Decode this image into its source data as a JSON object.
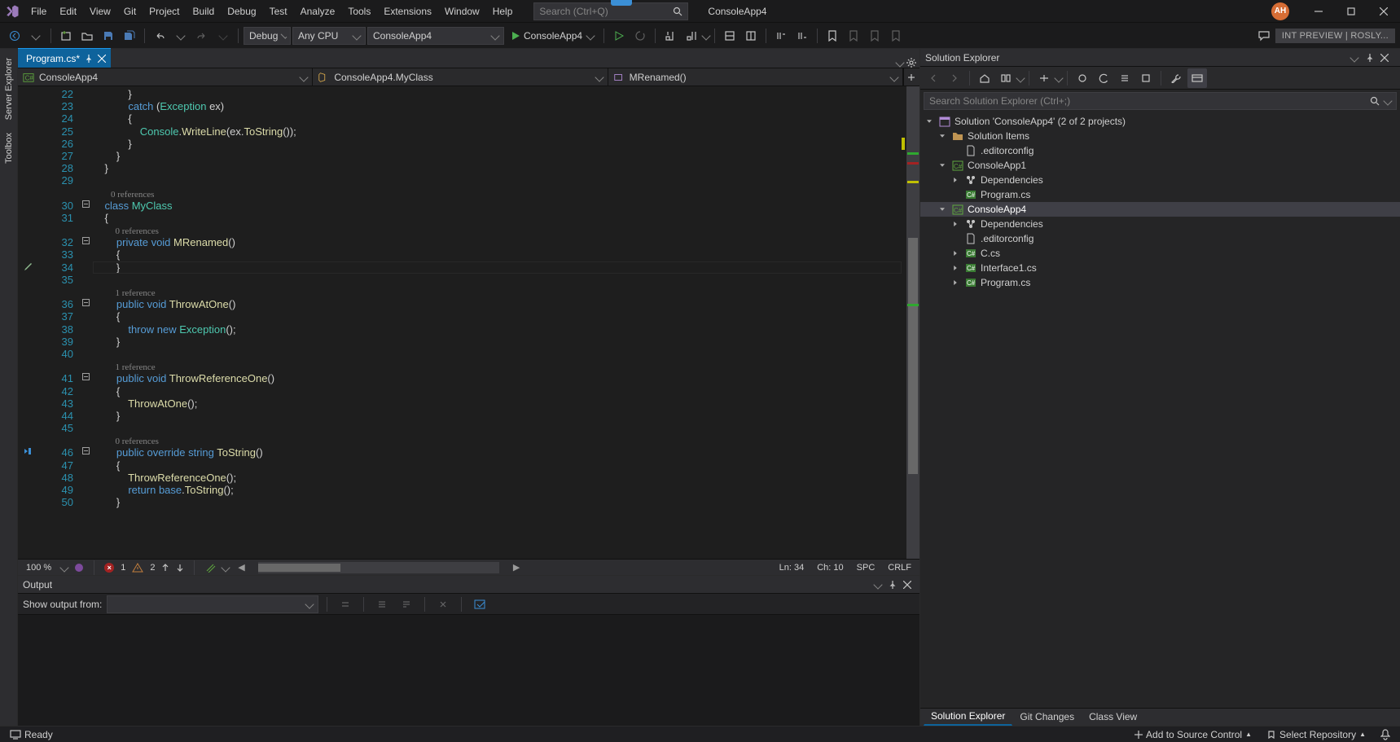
{
  "app_name": "ConsoleApp4",
  "menus": [
    "File",
    "Edit",
    "View",
    "Git",
    "Project",
    "Build",
    "Debug",
    "Test",
    "Analyze",
    "Tools",
    "Extensions",
    "Window",
    "Help"
  ],
  "search_placeholder": "Search (Ctrl+Q)",
  "avatar_initials": "AH",
  "toolbar": {
    "config": "Debug",
    "platform": "Any CPU",
    "startup": "ConsoleApp4",
    "run_label": "ConsoleApp4",
    "preview_badge": "INT PREVIEW | ROSLY..."
  },
  "left_rails": [
    "Server Explorer",
    "Toolbox"
  ],
  "doc_tab": {
    "title": "Program.cs*"
  },
  "navbar": {
    "project": "ConsoleApp4",
    "type": "ConsoleApp4.MyClass",
    "member": "MRenamed()"
  },
  "chart_data": null,
  "editor": {
    "first_line": 22,
    "lines": [
      {
        "n": 22,
        "html": "            }",
        "fold": false,
        "track": ""
      },
      {
        "n": 23,
        "html": "            <span class='kw'>catch</span> (<span class='tp'>Exception</span> ex)",
        "fold": false
      },
      {
        "n": 24,
        "html": "            {",
        "fold": false
      },
      {
        "n": 25,
        "html": "                <span class='tp'>Console</span>.<span class='mth'>WriteLine</span>(ex.<span class='mth'>ToString</span>());",
        "fold": false,
        "track": ""
      },
      {
        "n": 26,
        "html": "            }",
        "fold": false,
        "track": "y"
      },
      {
        "n": 27,
        "html": "        }",
        "fold": false
      },
      {
        "n": 28,
        "html": "    }",
        "fold": false
      },
      {
        "n": 29,
        "html": "",
        "fold": false
      },
      {
        "n": 0,
        "codelens": "0 references",
        "indent": 8
      },
      {
        "n": 30,
        "html": "    <span class='kw'>class</span> <span class='tp'>MyClass</span>",
        "fold": true
      },
      {
        "n": 31,
        "html": "    {",
        "fold": false
      },
      {
        "n": 0,
        "codelens": "0 references",
        "indent": 10
      },
      {
        "n": 32,
        "html": "        <span class='kw'>private</span> <span class='kw'>void</span> <span class='mth'>MRenamed</span>()",
        "fold": true
      },
      {
        "n": 33,
        "html": "        {",
        "fold": false
      },
      {
        "n": 34,
        "html": "        }",
        "fold": false,
        "caret": true,
        "glyph": "brush"
      },
      {
        "n": 35,
        "html": "",
        "fold": false
      },
      {
        "n": 0,
        "codelens": "1 reference",
        "indent": 10
      },
      {
        "n": 36,
        "html": "        <span class='kw'>public</span> <span class='kw'>void</span> <span class='mth'>ThrowAtOne</span>()",
        "fold": true
      },
      {
        "n": 37,
        "html": "        {",
        "fold": false
      },
      {
        "n": 38,
        "html": "            <span class='kw'>throw</span> <span class='kw'>new</span> <span class='tp'>Exception</span>();",
        "fold": false
      },
      {
        "n": 39,
        "html": "        }",
        "fold": false
      },
      {
        "n": 40,
        "html": "",
        "fold": false
      },
      {
        "n": 0,
        "codelens": "1 reference",
        "indent": 10
      },
      {
        "n": 41,
        "html": "        <span class='kw'>public</span> <span class='kw'>void</span> <span class='mth'>ThrowReferenceOne</span>()",
        "fold": true
      },
      {
        "n": 42,
        "html": "        {",
        "fold": false
      },
      {
        "n": 43,
        "html": "            <span class='mth'>ThrowAtOne</span>();",
        "fold": false
      },
      {
        "n": 44,
        "html": "        }",
        "fold": false
      },
      {
        "n": 45,
        "html": "",
        "fold": false
      },
      {
        "n": 0,
        "codelens": "0 references",
        "indent": 10
      },
      {
        "n": 46,
        "html": "        <span class='kw'>public</span> <span class='kw'>override</span> <span class='kw'>string</span> <span class='mth'>ToString</span>()",
        "fold": true,
        "glyph": "impl"
      },
      {
        "n": 47,
        "html": "        {",
        "fold": false
      },
      {
        "n": 48,
        "html": "            <span class='mth'>ThrowReferenceOne</span>();",
        "fold": false
      },
      {
        "n": 49,
        "html": "            <span class='kw'>return</span> <span class='kw'>base</span>.<span class='mth'>ToString</span>();",
        "fold": false
      },
      {
        "n": 50,
        "html": "        }",
        "fold": false
      }
    ],
    "overview_marks": [
      {
        "pct": 14,
        "color": "#2fa82f"
      },
      {
        "pct": 16,
        "color": "#a32222"
      },
      {
        "pct": 20,
        "color": "#c0c000"
      },
      {
        "pct": 46,
        "color": "#2fa82f"
      }
    ]
  },
  "editor_status": {
    "zoom": "100 %",
    "errors": "1",
    "warnings": "2",
    "ln": "Ln: 34",
    "ch": "Ch: 10",
    "ins": "SPC",
    "eol": "CRLF"
  },
  "output": {
    "title": "Output",
    "show_label": "Show output from:"
  },
  "solution_explorer": {
    "title": "Solution Explorer",
    "search_placeholder": "Search Solution Explorer (Ctrl+;)",
    "root": "Solution 'ConsoleApp4' (2 of 2 projects)",
    "tree": [
      {
        "d": 1,
        "exp": "open",
        "ico": "folder",
        "label": "Solution Items"
      },
      {
        "d": 2,
        "exp": "",
        "ico": "file",
        "label": ".editorconfig"
      },
      {
        "d": 1,
        "exp": "open",
        "ico": "csproj",
        "label": "ConsoleApp1"
      },
      {
        "d": 2,
        "exp": "closed",
        "ico": "dep",
        "label": "Dependencies"
      },
      {
        "d": 2,
        "exp": "",
        "ico": "cs",
        "label": "Program.cs"
      },
      {
        "d": 1,
        "exp": "open",
        "ico": "csproj",
        "label": "ConsoleApp4",
        "sel": true
      },
      {
        "d": 2,
        "exp": "closed",
        "ico": "dep",
        "label": "Dependencies"
      },
      {
        "d": 2,
        "exp": "",
        "ico": "file",
        "label": ".editorconfig"
      },
      {
        "d": 2,
        "exp": "closed",
        "ico": "cs",
        "label": "C.cs"
      },
      {
        "d": 2,
        "exp": "closed",
        "ico": "cs",
        "label": "Interface1.cs"
      },
      {
        "d": 2,
        "exp": "closed",
        "ico": "cs",
        "label": "Program.cs"
      }
    ],
    "tabs": [
      "Solution Explorer",
      "Git Changes",
      "Class View"
    ]
  },
  "statusbar": {
    "ready": "Ready",
    "source_control": "Add to Source Control",
    "repo": "Select Repository"
  }
}
